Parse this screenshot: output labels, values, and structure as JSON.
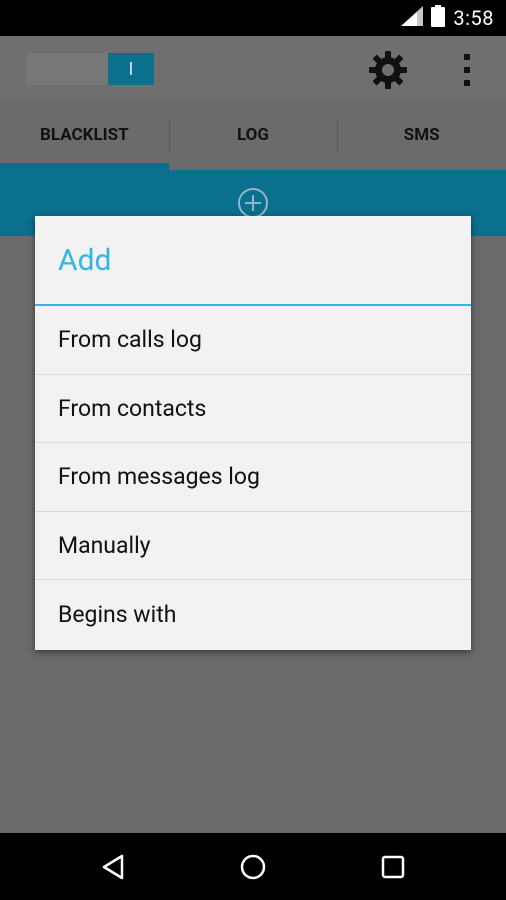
{
  "status_bar": {
    "time": "3:58",
    "icons": [
      "signal-icon",
      "battery-icon"
    ]
  },
  "toolbar": {
    "toggle_label": "I",
    "icons": [
      "gear-icon",
      "overflow-menu-icon"
    ]
  },
  "tabs": [
    {
      "label": "BLACKLIST",
      "active": true
    },
    {
      "label": "LOG",
      "active": false
    },
    {
      "label": "SMS",
      "active": false
    }
  ],
  "add_strip": {
    "icon": "add-circle-icon"
  },
  "dialog": {
    "title": "Add",
    "items": [
      "From calls log",
      "From contacts",
      "From messages log",
      "Manually",
      "Begins with"
    ]
  },
  "nav_bar": {
    "icons": [
      "back-icon",
      "home-icon",
      "recents-icon"
    ]
  },
  "colors": {
    "accent": "#33b5e5",
    "primary_dark": "#0b6f8e",
    "dialog_bg": "#f2f2f2"
  }
}
